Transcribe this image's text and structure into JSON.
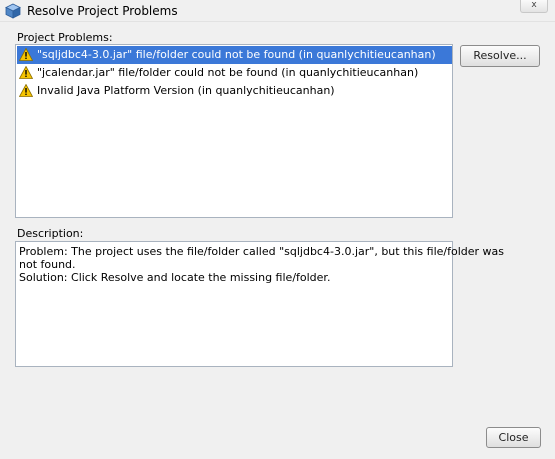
{
  "window": {
    "title": "Resolve Project Problems",
    "close_glyph": "x"
  },
  "problems": {
    "label": "Project Problems:",
    "items": [
      {
        "icon": "warning-icon",
        "text": "\"sqljdbc4-3.0.jar\" file/folder could not be found (in quanlychitieucanhan)",
        "selected": true
      },
      {
        "icon": "warning-icon",
        "text": "\"jcalendar.jar\" file/folder could not be found (in quanlychitieucanhan)",
        "selected": false
      },
      {
        "icon": "warning-icon",
        "text": "Invalid Java Platform Version (in quanlychitieucanhan)",
        "selected": false
      }
    ]
  },
  "description": {
    "label": "Description:",
    "lines": [
      "Problem: The project uses the file/folder called \"sqljdbc4-3.0.jar\", but this file/folder was",
      "not found.",
      "Solution: Click Resolve and locate the missing file/folder."
    ]
  },
  "buttons": {
    "resolve": "Resolve...",
    "close": "Close"
  },
  "colors": {
    "selection": "#3b78d8",
    "warning": "#f5c400"
  }
}
